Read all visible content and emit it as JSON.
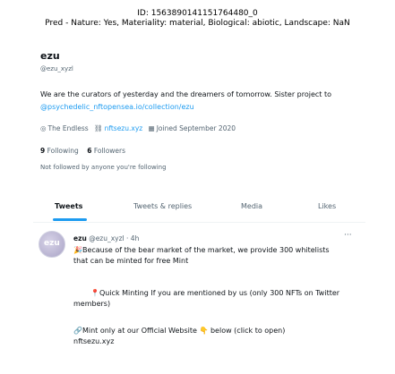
{
  "caption": {
    "line1": "ID: 1563890141151764480_0",
    "line2": "Pred - Nature: Yes, Materiality: material, Biological: abiotic, Landscape: NaN"
  },
  "profile": {
    "name": "ezu",
    "handle": "@ezu_xyzl",
    "bio_text": "We are the curators of yesterday and the dreamers of tomorrow. Sister project to",
    "bio_link": "@psychedelic_nftopensea.io/collection/ezu",
    "location": "The Endless",
    "website": "nftsezu.xyz",
    "joined": "Joined September 2020",
    "following_count": "9",
    "following_label": "Following",
    "followers_count": "6",
    "followers_label": "Followers",
    "not_followed": "Not followed by anyone you're following"
  },
  "tabs": [
    "Tweets",
    "Tweets & replies",
    "Media",
    "Likes"
  ],
  "tweet": {
    "avatar_text": "ezu",
    "name": "ezu",
    "handle": "@ezu_xyzl",
    "time": "· 4h",
    "more": "···",
    "line1": "Because of the bear market of the market, we provide 300 whitelists",
    "line2": "that can be minted for free Mint",
    "line3": "Quick Minting If you are mentioned by us (only 300 NFTs on Twitter",
    "line4": "members)",
    "line5": "Mint only at our Official Website",
    "line5_tail": "below (click to open)",
    "link": "nftsezu.xyz"
  }
}
